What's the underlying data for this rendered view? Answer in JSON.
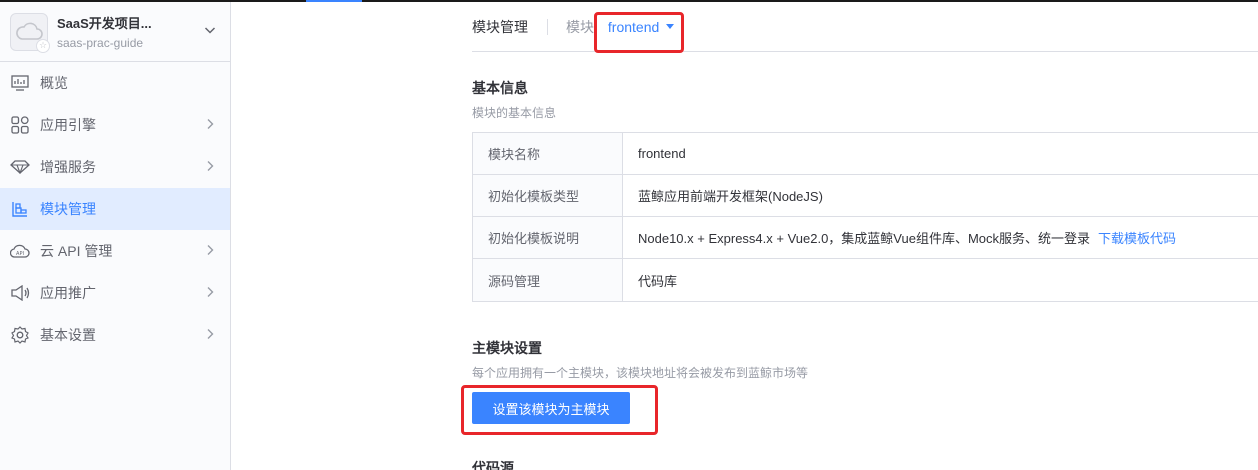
{
  "app": {
    "name": "SaaS开发项目...",
    "code": "saas-prac-guide"
  },
  "sidebar": {
    "items": [
      {
        "label": "概览",
        "icon": "overview-icon",
        "has_arrow": false,
        "active": false
      },
      {
        "label": "应用引擎",
        "icon": "app-engine-icon",
        "has_arrow": true,
        "active": false
      },
      {
        "label": "增强服务",
        "icon": "enhanced-service-icon",
        "has_arrow": true,
        "active": false
      },
      {
        "label": "模块管理",
        "icon": "module-icon",
        "has_arrow": false,
        "active": true
      },
      {
        "label": "云 API 管理",
        "icon": "cloud-api-icon",
        "has_arrow": true,
        "active": false
      },
      {
        "label": "应用推广",
        "icon": "promotion-icon",
        "has_arrow": true,
        "active": false
      },
      {
        "label": "基本设置",
        "icon": "settings-icon",
        "has_arrow": true,
        "active": false
      }
    ]
  },
  "header": {
    "title": "模块管理",
    "module_label": "模块:",
    "module_value": "frontend"
  },
  "basic_info": {
    "title": "基本信息",
    "desc": "模块的基本信息",
    "rows": [
      {
        "key": "模块名称",
        "value": "frontend"
      },
      {
        "key": "初始化模板类型",
        "value": "蓝鲸应用前端开发框架(NodeJS)"
      },
      {
        "key": "初始化模板说明",
        "value": "Node10.x + Express4.x + Vue2.0，集成蓝鲸Vue组件库、Mock服务、统一登录",
        "link": "下载模板代码"
      },
      {
        "key": "源码管理",
        "value": "代码库"
      }
    ]
  },
  "main_module": {
    "title": "主模块设置",
    "desc": "每个应用拥有一个主模块，该模块地址将会被发布到蓝鲸市场等",
    "button": "设置该模块为主模块"
  },
  "source": {
    "title": "代码源"
  },
  "colors": {
    "accent": "#3a84ff",
    "active_bg": "#e1ecff",
    "highlight": "#e8262a"
  }
}
